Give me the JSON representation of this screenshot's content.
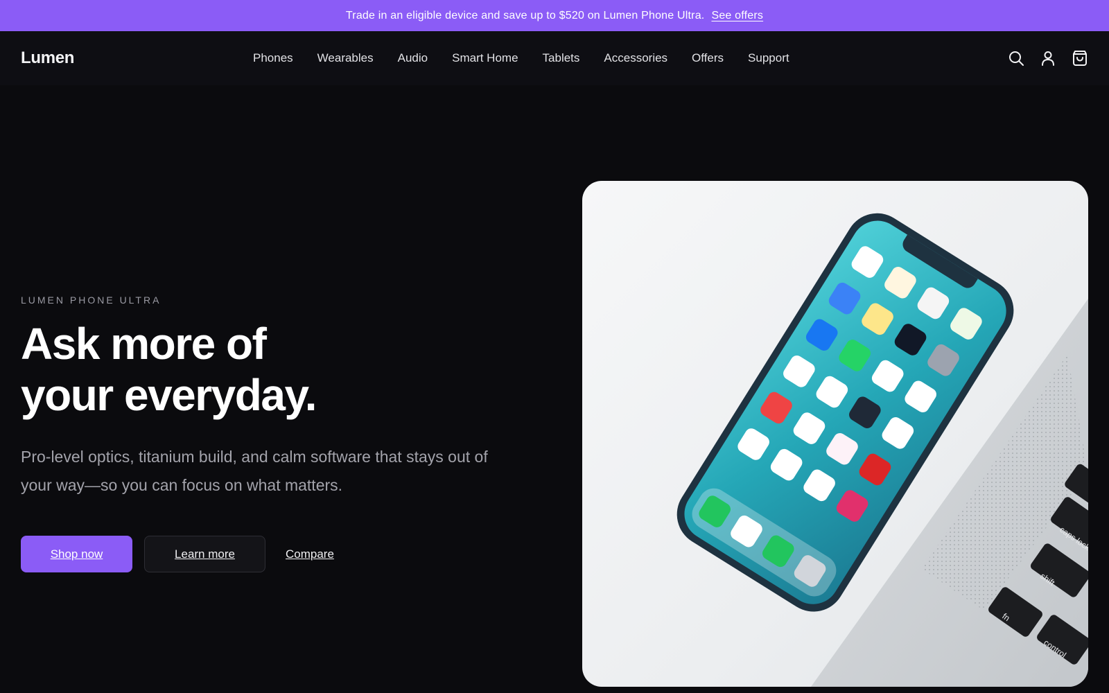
{
  "promo": {
    "text": "Trade in an eligible device and save up to $520 on Lumen Phone Ultra.",
    "link": "See offers"
  },
  "header": {
    "logo": "Lumen",
    "nav": [
      "Phones",
      "Wearables",
      "Audio",
      "Smart Home",
      "Tablets",
      "Accessories",
      "Offers",
      "Support"
    ],
    "icons": [
      "search-icon",
      "account-icon",
      "cart-icon"
    ]
  },
  "hero": {
    "eyebrow": "LUMEN PHONE ULTRA",
    "headline_line1": "Ask more of",
    "headline_line2": "your everyday.",
    "subtext": "Pro-level optics, titanium build, and calm software that stays out of your way—so you can focus on what matters.",
    "cta_primary": "Shop now",
    "cta_secondary": "Learn more",
    "cta_link": "Compare"
  },
  "colors": {
    "accent": "#8b5cf6",
    "background": "#0b0b0e"
  },
  "keyboard_keys": [
    "caps lock",
    "shift",
    "fn",
    "control"
  ]
}
